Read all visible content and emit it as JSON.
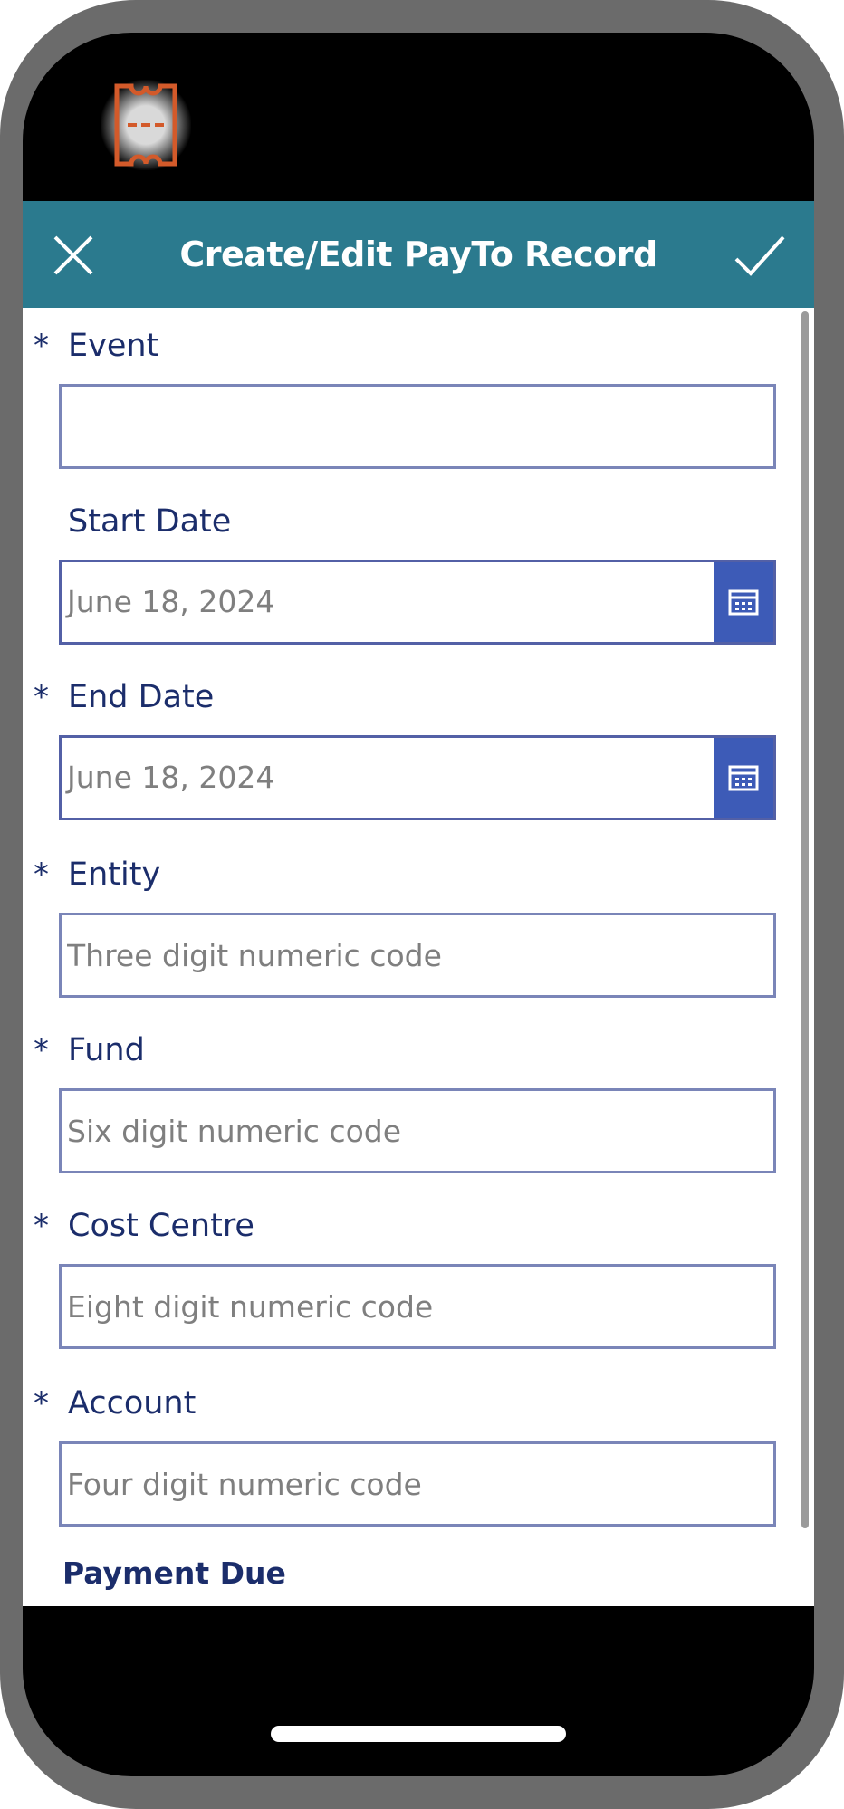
{
  "header": {
    "title": "Create/Edit PayTo Record"
  },
  "colors": {
    "header_bg": "#2b7a8e",
    "label": "#1b2d6b",
    "field_border": "#7a85b8",
    "calendar_btn": "#3d5bb7",
    "app_icon": "#d35a2a"
  },
  "icons": {
    "app": "ticket-icon",
    "close": "close-icon",
    "confirm": "check-icon",
    "calendar": "calendar-icon"
  },
  "form": {
    "event": {
      "required_mark": "*",
      "label": "Event",
      "value": "",
      "placeholder": ""
    },
    "start_date": {
      "label": "Start Date",
      "value": "June 18, 2024"
    },
    "end_date": {
      "required_mark": "*",
      "label": "End Date",
      "value": "June 18, 2024"
    },
    "entity": {
      "required_mark": "*",
      "label": "Entity",
      "value": "",
      "placeholder": "Three digit numeric code"
    },
    "fund": {
      "required_mark": "*",
      "label": "Fund",
      "value": "",
      "placeholder": "Six digit numeric code"
    },
    "cost_centre": {
      "required_mark": "*",
      "label": "Cost Centre",
      "value": "",
      "placeholder": "Eight digit numeric code"
    },
    "account": {
      "required_mark": "*",
      "label": "Account",
      "value": "",
      "placeholder": "Four digit numeric code"
    },
    "payment_due": {
      "label": "Payment Due"
    }
  }
}
